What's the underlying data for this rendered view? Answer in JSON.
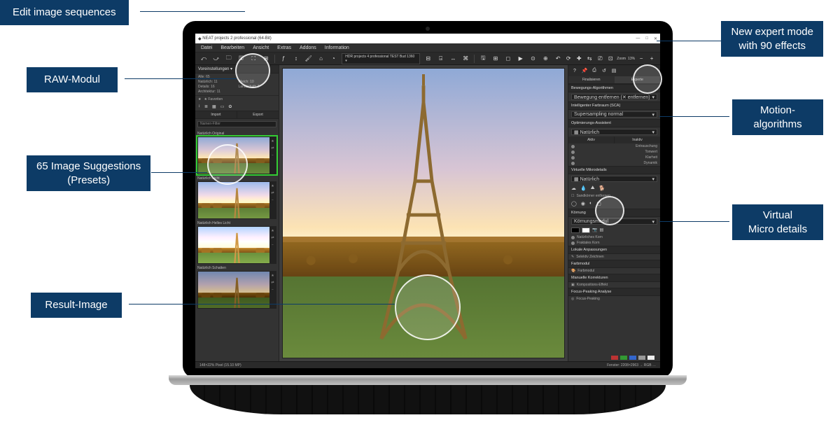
{
  "callouts": {
    "edit_sequences": "Edit image sequences",
    "raw_module": "RAW-Modul",
    "presets": "65 Image Suggestions\n(Presets)",
    "presets_l1": "65 Image Suggestions",
    "presets_l2": "(Presets)",
    "result_image": "Result-Image",
    "expert_mode_l1": "New expert mode",
    "expert_mode_l2": "with 90 effects",
    "motion_l1": "Motion-",
    "motion_l2": "algorithms",
    "microdetails_l1": "Virtual",
    "microdetails_l2": "Micro details"
  },
  "window": {
    "title": "NEAT projects 2 professional (64-Bit)",
    "minimize": "—",
    "maximize": "□",
    "close": "✕"
  },
  "menu": [
    "Datei",
    "Bearbeiten",
    "Ansicht",
    "Extras",
    "Addons",
    "Information"
  ],
  "toolbar": {
    "icons_left": [
      "⤺",
      "⤻",
      "🗀",
      "🖫",
      "⛶",
      "⊞",
      "|",
      "ƒ",
      "↕",
      "🖌",
      "⌂",
      "◔"
    ],
    "dd_label": "HDR projects 4 professional TEST Bud 1360 ▾",
    "icons_mid": [
      "⊟",
      "⍈",
      "↔",
      "⌘",
      "|",
      "🖫",
      "⊞",
      "◻",
      "▶",
      "⊙",
      "⊕"
    ],
    "icons_right": [
      "↶",
      "⟳",
      "✚",
      "⇆",
      "⎚",
      "⊡"
    ],
    "zoom_label": "Zoom",
    "zoom_value": "13%",
    "zoom_minus": "−",
    "zoom_plus": "+"
  },
  "left": {
    "panel_title": "Voreinstellungen ▾",
    "stats": {
      "alle": "Alle: 65",
      "natuerlich": "Natürlich: 11",
      "weich": "Weich: 10",
      "details": "Details: 16",
      "landschaft": "Landschaft: 7",
      "architektur": "Architektur: 11"
    },
    "fav_label": "★ Favoriten",
    "import": "Import",
    "export": "Export",
    "namefilter": "Namen-Filter",
    "presets": [
      {
        "label": "Natürlich Original",
        "selected": true
      },
      {
        "label": "Natürlich Licht",
        "selected": false
      },
      {
        "label": "Natürlich Helles Licht",
        "selected": false
      },
      {
        "label": "Natürlich Schatten",
        "selected": false
      }
    ]
  },
  "right": {
    "tabs": {
      "finalize": "Finalisieren",
      "expert": "Experte"
    },
    "motion_hdr": "Bewegungs-Algorithmen",
    "motion_item": "Bewegung entfernen (✕ entfernen)",
    "sca_hdr": "Intelligenter Farbraum (SCA)",
    "sca_item": "Supersampling normal",
    "opt_hdr": "Optimierungs-Assistent",
    "opt_sub": "Natürlich",
    "opt_two": {
      "a": "Aktiv",
      "b": "Inaktiv"
    },
    "opt_items": [
      "Entrauschung",
      "Tonwert",
      "Klarheit",
      "Dynamik"
    ],
    "vmd_hdr": "Virtuelle Mikrodetails",
    "vmd_item": "Natürlich",
    "vmd_sub": "Sandkörner entfernen",
    "grain_hdr": "Körnung",
    "grain_item": "Körnungsmodul",
    "grain_row1": "Natürliches Korn",
    "grain_row2": "Fraktales Korn",
    "local_hdr": "Lokale Anpassungen",
    "local_item": "Selektiv Zeichnen",
    "color_hdr": "Farbmodul",
    "color_item": "Farbmodul",
    "fx_hdr": "Manuelle Korrekturen",
    "fx_item": "Kompositions-Effekt",
    "focus_hdr": "Focus-Peaking Analyse",
    "focus_item": "Focus-Peaking"
  },
  "status": {
    "left": "148×22%  Pixel (15.10 MP)",
    "right": "Fenster: 2208×2963 → RGB …",
    "pill_colors": [
      "#b33",
      "#393",
      "#36c",
      "#999",
      "#eee"
    ]
  }
}
